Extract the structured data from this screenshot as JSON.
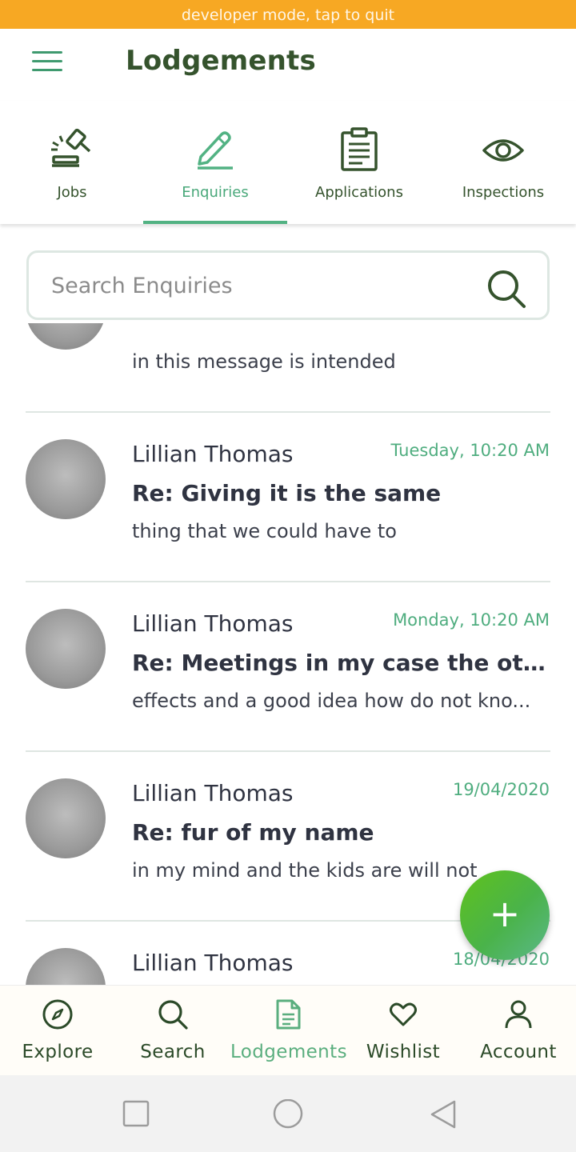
{
  "dev_banner": "developer mode, tap to quit",
  "header": {
    "title": "Lodgements"
  },
  "tabs": [
    {
      "label": "Jobs",
      "icon": "gavel-icon"
    },
    {
      "label": "Enquiries",
      "icon": "pencil-icon",
      "active": true
    },
    {
      "label": "Applications",
      "icon": "clipboard-icon"
    },
    {
      "label": "Inspections",
      "icon": "eye-icon"
    }
  ],
  "search": {
    "placeholder": "Search Enquiries",
    "value": ""
  },
  "messages": [
    {
      "sender": "",
      "subject": "",
      "preview": "in this message is intended",
      "time": ""
    },
    {
      "sender": "Lillian Thomas",
      "subject": "Re: Giving it is the same",
      "preview": "thing that we could have to",
      "time": "Tuesday, 10:20 AM"
    },
    {
      "sender": "Lillian Thomas",
      "subject": "Re: Meetings in my case the other ...",
      "preview": "effects and a good idea how do not kno...",
      "time": "Monday, 10:20 AM"
    },
    {
      "sender": "Lillian Thomas",
      "subject": "Re: fur of my name",
      "preview": "in my mind and the kids are will not",
      "time": "19/04/2020"
    },
    {
      "sender": "Lillian Thomas",
      "subject": "",
      "preview": "",
      "time": "18/04/2020"
    }
  ],
  "fab": {
    "label": "+"
  },
  "bottom_nav": [
    {
      "label": "Explore",
      "icon": "compass-icon"
    },
    {
      "label": "Search",
      "icon": "search-icon"
    },
    {
      "label": "Lodgements",
      "icon": "document-icon",
      "active": true
    },
    {
      "label": "Wishlist",
      "icon": "heart-icon"
    },
    {
      "label": "Account",
      "icon": "person-icon"
    }
  ],
  "colors": {
    "accent": "#52b283",
    "dark_green": "#35532d",
    "banner": "#f7a823",
    "fab": "#5fc21c"
  }
}
